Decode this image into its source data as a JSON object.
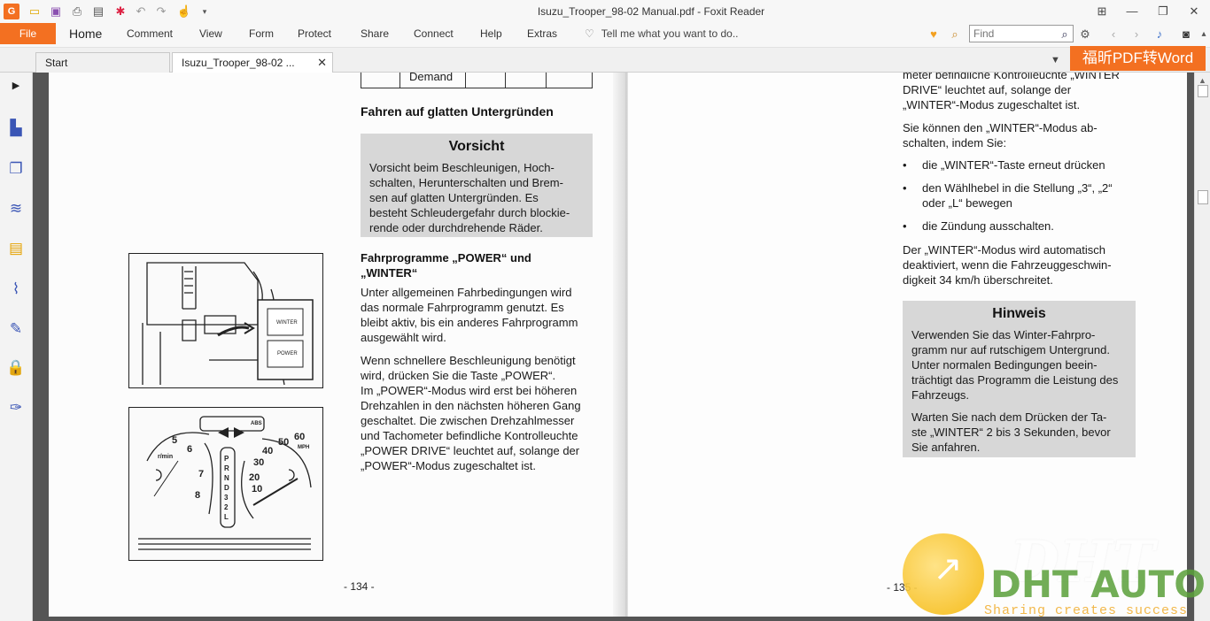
{
  "app": {
    "title": "Isuzu_Trooper_98-02 Manual.pdf - Foxit Reader",
    "accent": "#f37021"
  },
  "quick_access": [
    "app-logo-icon",
    "open-icon",
    "save-icon",
    "print-icon",
    "properties-icon",
    "new-icon",
    "undo-icon",
    "redo-icon",
    "hand-tool-icon",
    "customize-icon"
  ],
  "ribbon": {
    "file": "File",
    "tabs": [
      "Home",
      "Comment",
      "View",
      "Form",
      "Protect",
      "Share",
      "Connect",
      "Help",
      "Extras"
    ],
    "tell_me": "Tell me what you want to do..",
    "find_placeholder": "Find"
  },
  "doc_tabs": {
    "start": "Start",
    "document": "Isuzu_Trooper_98-02 ...",
    "promo": "福昕PDF转Word"
  },
  "left_page": {
    "table_cell": "Demand",
    "heading1": "Fahren auf glatten Untergründen",
    "caution_title": "Vorsicht",
    "caution_lines": [
      "Vorsicht beim Beschleunigen, Hoch-",
      "schalten, Herunterschalten und Brem-",
      "sen auf glatten Untergründen. Es",
      "besteht Schleudergefahr durch blockie-",
      "rende oder durchdrehende Räder."
    ],
    "heading2_lines": [
      "Fahrprogramme „POWER“ und",
      "„WINTER“"
    ],
    "para1_lines": [
      "Unter allgemeinen Fahrbedingungen wird",
      "das normale Fahrprogramm genutzt. Es",
      "bleibt aktiv, bis ein anderes Fahrprogramm",
      "ausgewählt wird."
    ],
    "para2_lines": [
      "Wenn schnellere Beschleunigung benötigt",
      "wird, drücken Sie die Taste „POWER“.",
      "Im „POWER“-Modus wird erst bei höheren",
      "Drehzahlen in den nächsten höheren Gang",
      "geschaltet. Die zwischen Drehzahlmesser",
      "und Tachometer befindliche Kontrolleuchte",
      "„POWER DRIVE“ leuchtet auf, solange der",
      "„POWER“-Modus zugeschaltet ist."
    ],
    "fig1_labels": {
      "winter": "WINTER",
      "power": "POWER"
    },
    "fig2_labels": {
      "rpm": "r/min",
      "mph": "MPH",
      "abs": "ABS",
      "gears": "PRND32L"
    },
    "page_number": "- 134 -"
  },
  "right_page": {
    "top_lines": [
      "meter befindliche Kontrolleuchte „WINTER",
      "DRIVE“ leuchtet auf, solange der",
      "„WINTER“-Modus zugeschaltet ist."
    ],
    "para1_lines": [
      "Sie können den „WINTER“-Modus ab-",
      "schalten, indem Sie:"
    ],
    "bullets": [
      [
        "die „WINTER“-Taste erneut drücken"
      ],
      [
        "den Wählhebel in die Stellung „3“, „2“",
        "oder „L“ bewegen"
      ],
      [
        "die Zündung ausschalten."
      ]
    ],
    "para2_lines": [
      "Der „WINTER“-Modus wird automatisch",
      "deaktiviert, wenn die Fahrzeuggeschwin-",
      "digkeit 34 km/h überschreitet."
    ],
    "note_title": "Hinweis",
    "note_lines1": [
      "Verwenden Sie das Winter-Fahrpro-",
      "gramm nur auf rutschigem Untergrund.",
      "Unter normalen Bedingungen beein-",
      "trächtigt das Programm die Leistung des",
      "Fahrzeugs."
    ],
    "note_lines2": [
      "Warten Sie nach dem Drücken der Ta-",
      "ste „WINTER“ 2 bis 3 Sekunden, bevor",
      "Sie anfahren."
    ],
    "page_number": "- 135 -"
  },
  "watermark": {
    "logo": "DHT AUTO",
    "slogan": "Sharing creates success"
  }
}
